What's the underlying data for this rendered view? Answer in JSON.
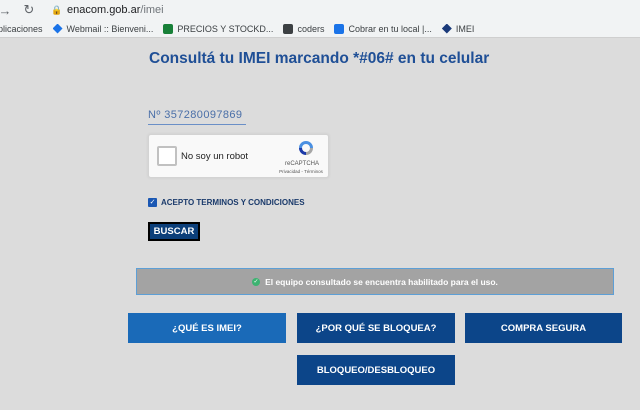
{
  "browser": {
    "url_host": "enacom.gob.ar",
    "url_path": "/imei"
  },
  "bookmarks": [
    {
      "label": "plicaciones",
      "icon": "apps-icon"
    },
    {
      "label": "Webmail :: Bienveni...",
      "icon": "webmail-icon"
    },
    {
      "label": "PRECIOS Y STOCKD...",
      "icon": "sheets-icon"
    },
    {
      "label": "coders",
      "icon": "coders-icon"
    },
    {
      "label": "Cobrar en tu local |...",
      "icon": "mercadopago-icon"
    },
    {
      "label": "IMEI",
      "icon": "enacom-icon"
    }
  ],
  "page": {
    "title": "Consultá tu IMEI marcando *#06# en tu celular",
    "imei_value": "Nº  357280097869",
    "captcha": {
      "label": "No soy un robot",
      "brand": "reCAPTCHA",
      "links": "Privacidad - Términos"
    },
    "terms_label": "ACEPTO TERMINOS Y CONDICIONES",
    "terms_checked": true,
    "search_button": "BUSCAR",
    "result_message": "El equipo consultado se encuentra habilitado para el uso.",
    "buttons": {
      "what_is_imei": "¿QUÉ ES IMEI?",
      "why_blocked": "¿POR QUÉ SE BLOQUEA?",
      "safe_purchase": "COMPRA SEGURA",
      "block_unblock": "BLOQUEO/DESBLOQUEO"
    }
  },
  "colors": {
    "title": "#1f4f96",
    "button_dark": "#0c4589",
    "button_light": "#1a6ab8",
    "result_bg": "#a3a3a3",
    "success": "#3cb371"
  }
}
